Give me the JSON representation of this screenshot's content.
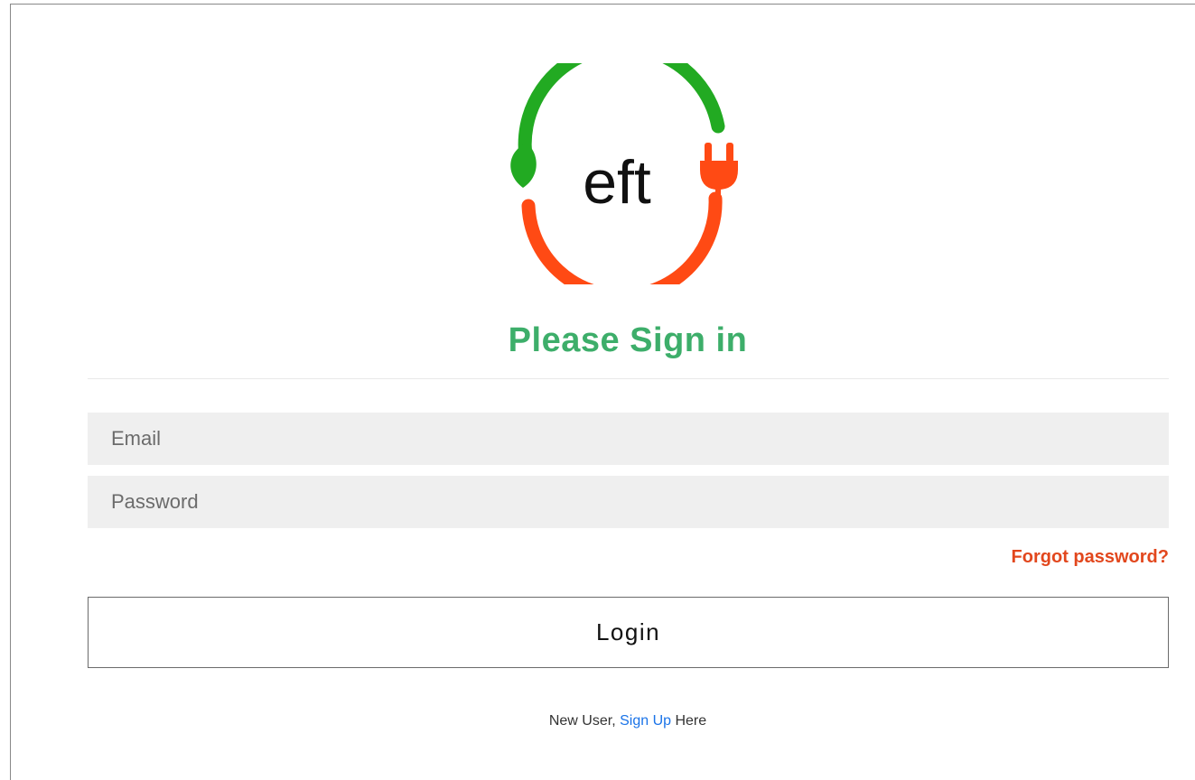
{
  "logo": {
    "text": "eft",
    "colors": {
      "green": "#22aa22",
      "orange": "#ff4a14",
      "text": "#111111"
    }
  },
  "form": {
    "title": "Please Sign in",
    "email_placeholder": "Email",
    "password_placeholder": "Password",
    "forgot_label": "Forgot password?",
    "login_label": "Login"
  },
  "signup": {
    "prefix": "New User, ",
    "link_label": "Sign Up",
    "suffix": " Here"
  },
  "colors": {
    "title": "#3dae6a",
    "forgot": "#e2471d",
    "link": "#1a73e8"
  }
}
